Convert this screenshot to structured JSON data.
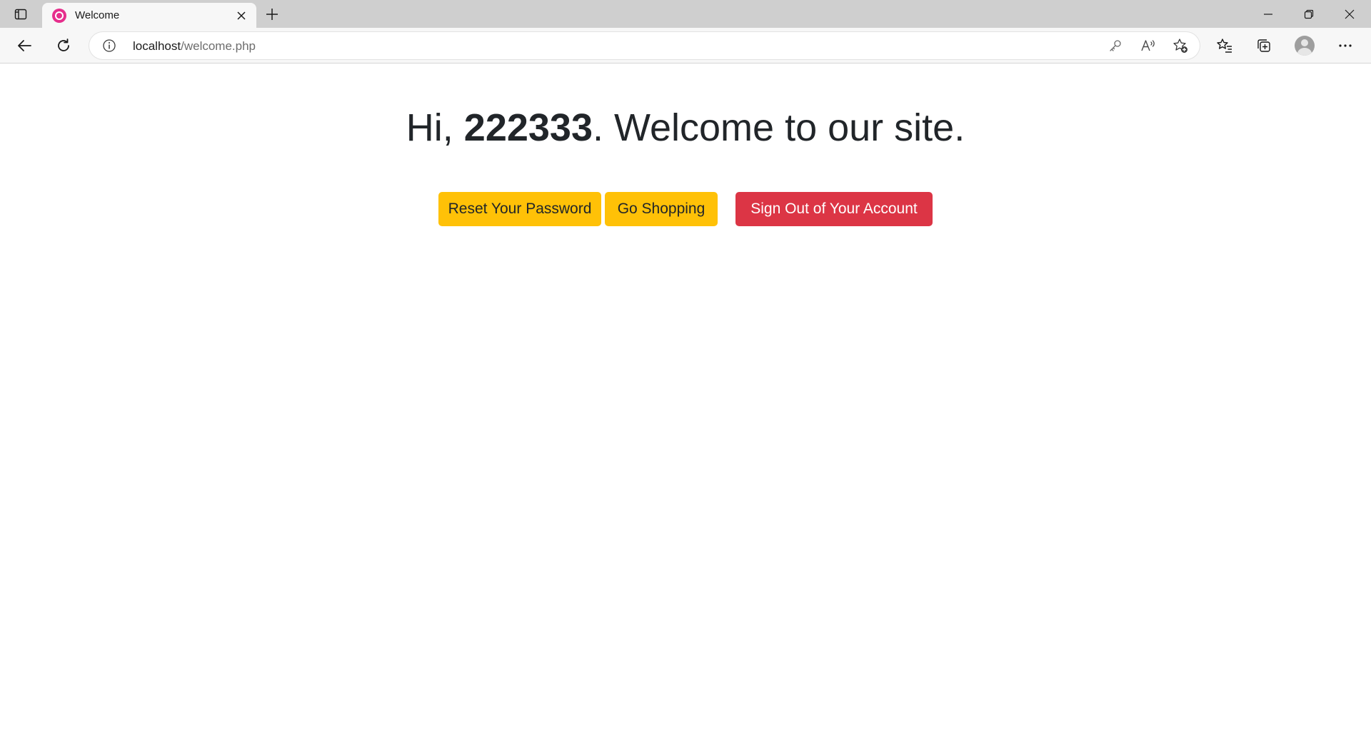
{
  "browser": {
    "tab": {
      "title": "Welcome",
      "favicon": "wampserver-icon"
    },
    "address_bar": {
      "host": "localhost",
      "path": "/welcome.php"
    },
    "colors": {
      "tabstrip": "#cfcfcf",
      "toolbar": "#f7f7f7",
      "favicon": "#e62e8c"
    }
  },
  "page": {
    "greeting_prefix": "Hi, ",
    "username": "222333",
    "greeting_suffix": ". Welcome to our site.",
    "buttons": {
      "reset_password": "Reset Your Password",
      "shopping": "Go Shopping",
      "sign_out": "Sign Out of Your Account"
    },
    "colors": {
      "warning": "#ffc107",
      "danger": "#dc3545",
      "text": "#212529"
    }
  }
}
